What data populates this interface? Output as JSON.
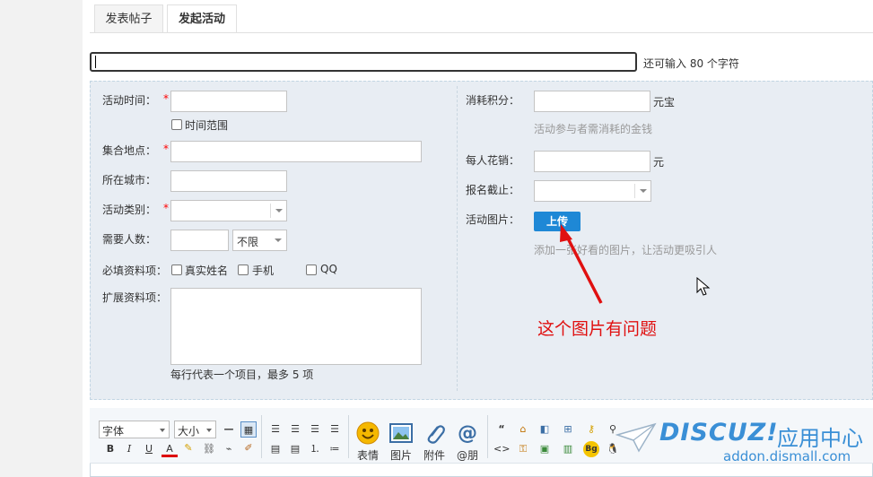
{
  "tabs": [
    {
      "label": "发表帖子",
      "active": false
    },
    {
      "label": "发起活动",
      "active": true
    }
  ],
  "title_field": {
    "value": "",
    "hint": "还可输入 80 个字符"
  },
  "form_left": {
    "time_label": "活动时间：",
    "time_range_label": "时间范围",
    "place_label": "集合地点：",
    "city_label": "所在城市：",
    "category_label": "活动类别：",
    "people_label": "需要人数：",
    "people_limit_option": "不限",
    "required_label": "必填资料项：",
    "required_options": [
      "真实姓名",
      "手机",
      "QQ"
    ],
    "extend_label": "扩展资料项：",
    "extend_hint": "每行代表一个项目，最多 5 项",
    "required_mark": "*"
  },
  "form_right": {
    "points_label": "消耗积分：",
    "points_unit": "元宝",
    "points_hint": "活动参与者需消耗的金钱",
    "cost_label": "每人花销：",
    "cost_unit": "元",
    "deadline_label": "报名截止：",
    "image_label": "活动图片：",
    "upload_label": "上传",
    "image_hint": "添加一张好看的图片，让活动更吸引人"
  },
  "annotation": {
    "text": "这个图片有问题",
    "color": "#e01010"
  },
  "toolbar": {
    "font_select": "字体",
    "size_select": "大小",
    "emoji_label": "表情",
    "image_label": "图片",
    "attach_label": "附件",
    "at_label": "@朋",
    "bold": "B",
    "italic": "I",
    "underline": "U",
    "font_color": "A"
  },
  "watermark": {
    "logo": "DISCUZ!",
    "cn": "应用中心",
    "url": "addon.dismall.com"
  },
  "colors": {
    "accent": "#1e88d6",
    "panel_bg": "#e8edf3",
    "required": "#ff0000"
  }
}
